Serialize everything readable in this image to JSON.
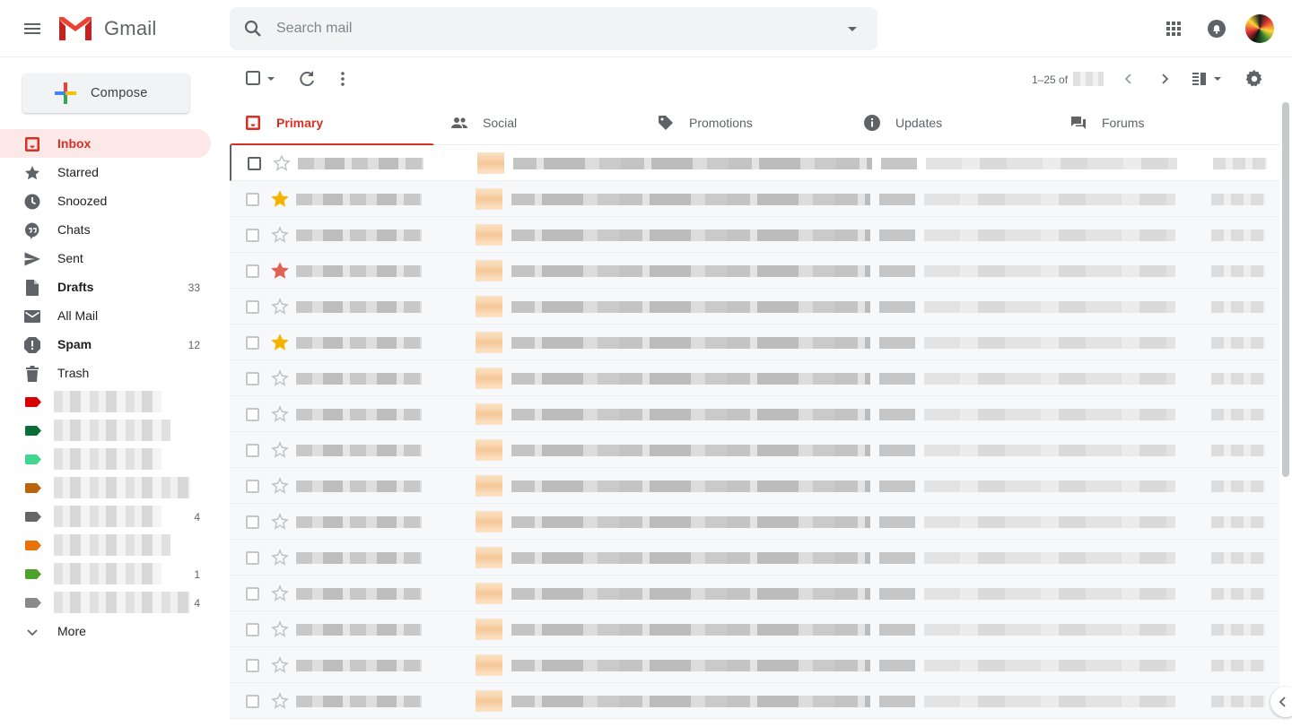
{
  "app": {
    "name": "Gmail"
  },
  "search": {
    "placeholder": "Search mail"
  },
  "compose": {
    "label": "Compose"
  },
  "nav": [
    {
      "label": "Inbox",
      "icon": "inbox-icon",
      "active": true
    },
    {
      "label": "Starred",
      "icon": "star-icon"
    },
    {
      "label": "Snoozed",
      "icon": "clock-icon"
    },
    {
      "label": "Chats",
      "icon": "chat-icon"
    },
    {
      "label": "Sent",
      "icon": "send-icon"
    },
    {
      "label": "Drafts",
      "icon": "draft-icon",
      "count": "33",
      "bold": true
    },
    {
      "label": "All Mail",
      "icon": "mail-icon"
    },
    {
      "label": "Spam",
      "icon": "spam-icon",
      "count": "12",
      "bold": true
    },
    {
      "label": "Trash",
      "icon": "trash-icon"
    }
  ],
  "labels": [
    {
      "color": "#d50000",
      "count": ""
    },
    {
      "color": "#0b6e3a",
      "count": ""
    },
    {
      "color": "#42d692",
      "count": ""
    },
    {
      "color": "#b8650c",
      "count": ""
    },
    {
      "color": "#666666",
      "count": "4"
    },
    {
      "color": "#e8710a",
      "count": ""
    },
    {
      "color": "#4fa12c",
      "count": "1"
    },
    {
      "color": "#8a8a8a",
      "count": "4"
    }
  ],
  "more": {
    "label": "More"
  },
  "pager": {
    "text": "1–25 of"
  },
  "tabs": [
    {
      "label": "Primary",
      "icon": "inbox-icon",
      "active": true
    },
    {
      "label": "Social",
      "icon": "people-icon"
    },
    {
      "label": "Promotions",
      "icon": "tag-icon"
    },
    {
      "label": "Updates",
      "icon": "info-icon"
    },
    {
      "label": "Forums",
      "icon": "forum-icon"
    }
  ],
  "messages": [
    {
      "star": "none"
    },
    {
      "star": "yellow"
    },
    {
      "star": "none"
    },
    {
      "star": "red"
    },
    {
      "star": "none"
    },
    {
      "star": "yellow"
    },
    {
      "star": "none"
    },
    {
      "star": "none"
    },
    {
      "star": "none"
    },
    {
      "star": "none"
    },
    {
      "star": "none"
    },
    {
      "star": "none"
    },
    {
      "star": "none"
    },
    {
      "star": "none"
    },
    {
      "star": "none"
    },
    {
      "star": "none"
    }
  ],
  "colors": {
    "accent": "#d93025",
    "star_yellow": "#f4b400",
    "star_red": "#e06055"
  }
}
